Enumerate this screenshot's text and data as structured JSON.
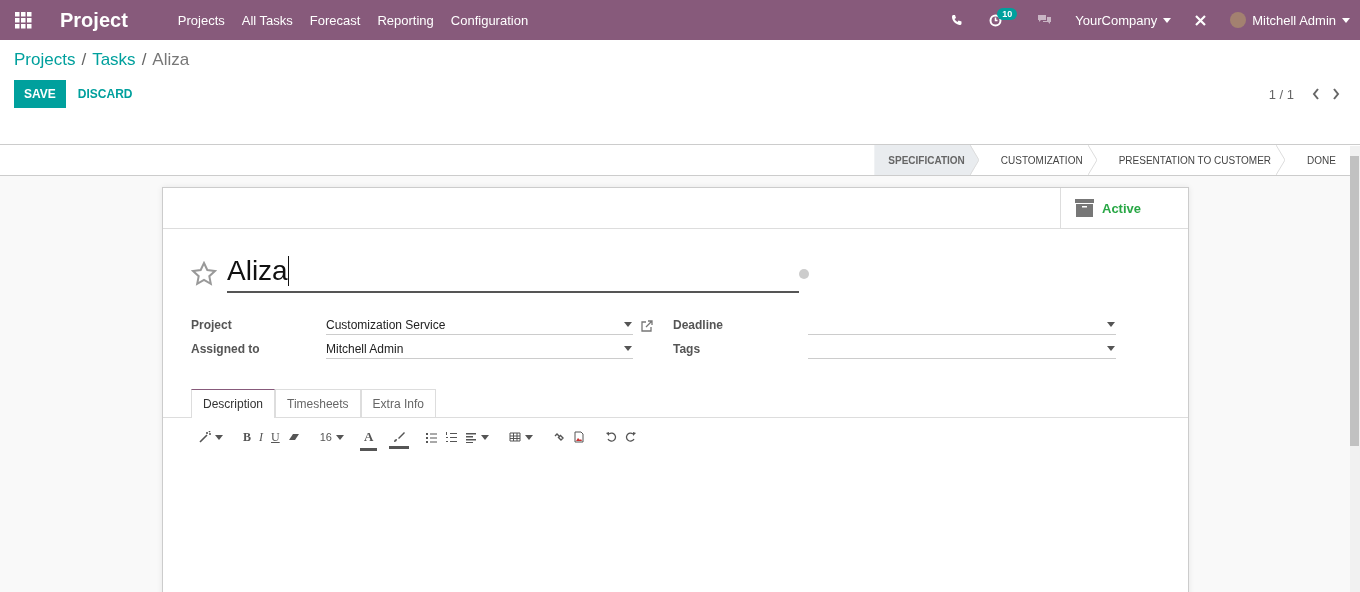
{
  "navbar": {
    "app_name": "Project",
    "menu": [
      "Projects",
      "All Tasks",
      "Forecast",
      "Reporting",
      "Configuration"
    ],
    "activity_count": "10",
    "company": "YourCompany",
    "user": "Mitchell Admin"
  },
  "breadcrumb": [
    {
      "kind": "link",
      "text": "Projects"
    },
    {
      "kind": "separator",
      "text": "/"
    },
    {
      "kind": "link",
      "text": "Tasks"
    },
    {
      "kind": "separator",
      "text": "/"
    },
    {
      "kind": "current",
      "text": "Aliza"
    }
  ],
  "buttons": {
    "save": "SAVE",
    "discard": "DISCARD"
  },
  "pager": "1 / 1",
  "stages": [
    {
      "label": "SPECIFICATION",
      "selected": true
    },
    {
      "label": "CUSTOMIZATION",
      "selected": false
    },
    {
      "label": "PRESENTATION TO CUSTOMER",
      "selected": false
    },
    {
      "label": "DONE",
      "selected": false
    }
  ],
  "active_button": "Active",
  "task": {
    "name": "Aliza",
    "starred": false
  },
  "fields_left": [
    {
      "label": "Project",
      "value": "Customization Service",
      "external_link": true
    },
    {
      "label": "Assigned to",
      "value": "Mitchell Admin",
      "external_link": false
    }
  ],
  "fields_right": [
    {
      "label": "Deadline"
    },
    {
      "label": "Tags"
    }
  ],
  "tabs": [
    {
      "label": "Description",
      "selected": true
    },
    {
      "label": "Timesheets",
      "selected": false
    },
    {
      "label": "Extra Info",
      "selected": false
    }
  ],
  "editor_toolbar": {
    "bold": "B",
    "italic": "I",
    "underline": "U",
    "font_size": "16",
    "font_color": "A"
  }
}
